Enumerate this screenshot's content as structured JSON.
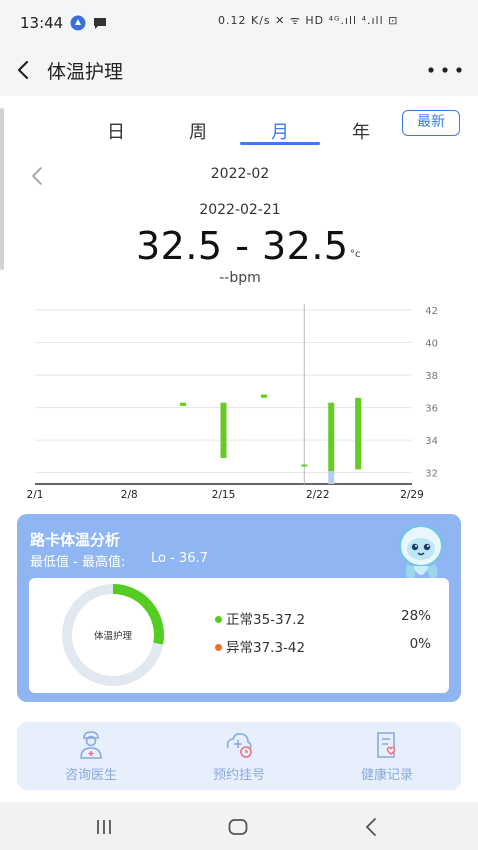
{
  "status_bar": {
    "time": "13:44",
    "right_text": "0.12 K/s ✕ ᯤ HD ⁴ᴳ.ıll ⁴.ıll ⊡"
  },
  "app_bar": {
    "title": "体温护理"
  },
  "tabs": [
    {
      "label": "日"
    },
    {
      "label": "周"
    },
    {
      "label": "月"
    },
    {
      "label": "年"
    }
  ],
  "active_tab": "月",
  "latest_button": "最新",
  "period": "2022-02",
  "selected": {
    "date": "2022-02-21",
    "temp_range": "32.5 - 32.5",
    "unit": "°c",
    "bpm": "--bpm"
  },
  "chart_data": {
    "type": "bar",
    "subtype": "range-bar",
    "x_tick_labels": [
      "2/1",
      "2/8",
      "2/15",
      "2/22",
      "2/29"
    ],
    "y_tick_labels": [
      "42",
      "40",
      "38",
      "36",
      "34",
      "32"
    ],
    "ylim": [
      31.3,
      42
    ],
    "xlim": [
      1,
      29
    ],
    "grid": true,
    "y_axis_side": "right",
    "bar_color": "#66cc22",
    "bars": [
      {
        "day": 12,
        "low": 36.1,
        "high": 36.3
      },
      {
        "day": 15,
        "low": 32.9,
        "high": 36.3
      },
      {
        "day": 18,
        "low": 36.6,
        "high": 36.8
      },
      {
        "day": 21,
        "low": 32.5,
        "high": 32.5
      },
      {
        "day": 23,
        "low": 32.1,
        "high": 36.3
      },
      {
        "day": 25,
        "low": 32.2,
        "high": 36.6
      }
    ],
    "selected_day": 21
  },
  "analysis": {
    "title": "路卡体温分析",
    "range_label": "最低值 - 最高值:",
    "range_value": "Lo - 36.7",
    "donut_center": "体温护理",
    "donut_fraction_normal": 0.28,
    "colors": {
      "normal": "#55cc22",
      "abnormal": "#f07020",
      "track": "#e2e8f0"
    },
    "items": [
      {
        "label": "正常35-37.2",
        "percent": "28%"
      },
      {
        "label": "异常37.3-42",
        "percent": "0%"
      }
    ]
  },
  "actions": [
    {
      "label": "咨询医生",
      "icon": "doctor-icon"
    },
    {
      "label": "预约挂号",
      "icon": "appointment-icon"
    },
    {
      "label": "健康记录",
      "icon": "health-record-icon"
    }
  ],
  "colors": {
    "accent": "#3c7bea",
    "card": "#8fb5f3"
  }
}
